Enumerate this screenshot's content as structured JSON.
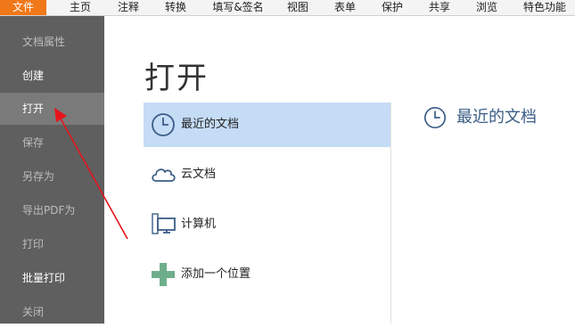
{
  "menubar": {
    "items": [
      {
        "label": "文件",
        "active": true
      },
      {
        "label": "主页"
      },
      {
        "label": "注释"
      },
      {
        "label": "转换"
      },
      {
        "label": "填写&签名"
      },
      {
        "label": "视图"
      },
      {
        "label": "表单"
      },
      {
        "label": "保护"
      },
      {
        "label": "共享"
      },
      {
        "label": "浏览"
      },
      {
        "label": "特色功能"
      }
    ]
  },
  "sidebar": {
    "items": [
      {
        "label": "文档属性",
        "state": "disabled"
      },
      {
        "label": "创建",
        "state": "enabled"
      },
      {
        "label": "打开",
        "state": "selected"
      },
      {
        "label": "保存",
        "state": "disabled"
      },
      {
        "label": "另存为",
        "state": "disabled"
      },
      {
        "label": "导出PDF为",
        "state": "disabled"
      },
      {
        "label": "打印",
        "state": "disabled"
      },
      {
        "label": "批量打印",
        "state": "enabled"
      },
      {
        "label": "关闭",
        "state": "disabled"
      }
    ]
  },
  "content": {
    "title": "打开",
    "locations": [
      {
        "label": "最近的文档",
        "icon": "clock-icon",
        "selected": true
      },
      {
        "label": "云文档",
        "icon": "cloud-icon"
      },
      {
        "label": "计算机",
        "icon": "computer-icon"
      },
      {
        "label": "添加一个位置",
        "icon": "plus-icon"
      }
    ],
    "recent_header": "最近的文档"
  },
  "colors": {
    "menu_active": "#f07818",
    "sidebar_bg": "#5f5f5f",
    "sidebar_selected": "#7a7a7a",
    "list_selected": "#c5dcf6",
    "accent_blue": "#3a5d86",
    "plus_green": "#6fae8c",
    "annotation_arrow": "#e8141c"
  }
}
